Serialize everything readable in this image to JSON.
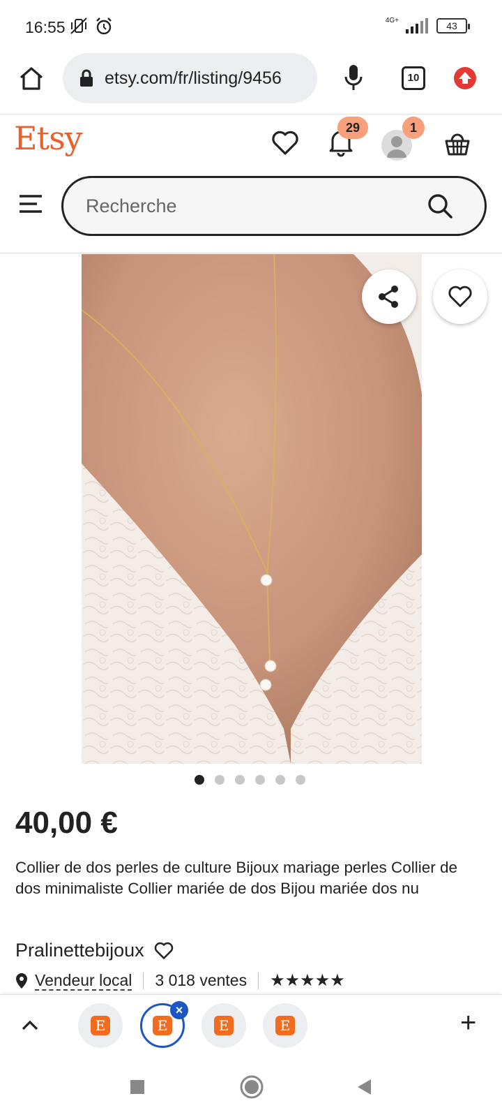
{
  "status_bar": {
    "time": "16:55",
    "network": "4G+",
    "battery": "43"
  },
  "browser": {
    "url": "etsy.com/fr/listing/9456",
    "tab_count": "10"
  },
  "header": {
    "logo": "Etsy",
    "notifications_count": "29",
    "account_badge": "1"
  },
  "search": {
    "placeholder": "Recherche"
  },
  "carousel": {
    "total_images": 6,
    "active_index": 0
  },
  "listing": {
    "price": "40,00 €",
    "title": "Collier de dos perles de culture Bijoux mariage perles Collier de dos minimaliste Collier mariée de dos Bijou mariée dos nu",
    "shop_name": "Pralinettebijoux",
    "local_seller": "Vendeur local",
    "sales": "3 018 ventes",
    "rating_stars": 5,
    "stars_text": "★★★★★"
  },
  "tab_strip": {
    "tab_letter": "E",
    "close_glyph": "×",
    "add_glyph": "+"
  },
  "colors": {
    "brand": "#e8602c",
    "badge": "#f7a07a",
    "active_tab": "#1a56c4",
    "record_button": "#e53935"
  }
}
